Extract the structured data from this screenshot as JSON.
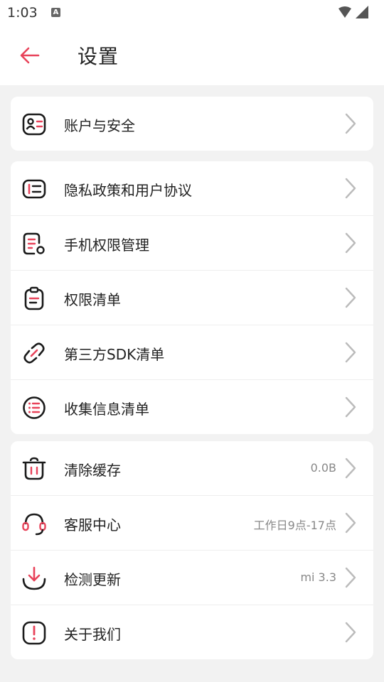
{
  "status": {
    "time": "1:03",
    "notif_glyph": "A"
  },
  "header": {
    "title": "设置"
  },
  "colors": {
    "accent": "#e8435a",
    "icon_dark": "#1a1a1a",
    "chevron": "#bbbbbb"
  },
  "groups": [
    {
      "items": [
        {
          "label": "账户与安全",
          "icon": "account-icon",
          "value": ""
        }
      ]
    },
    {
      "items": [
        {
          "label": "隐私政策和用户协议",
          "icon": "privacy-policy-icon",
          "value": ""
        },
        {
          "label": "手机权限管理",
          "icon": "permission-manage-icon",
          "value": ""
        },
        {
          "label": "权限清单",
          "icon": "clipboard-icon",
          "value": ""
        },
        {
          "label": "第三方SDK清单",
          "icon": "link-icon",
          "value": ""
        },
        {
          "label": "收集信息清单",
          "icon": "list-icon",
          "value": ""
        }
      ]
    },
    {
      "items": [
        {
          "label": "清除缓存",
          "icon": "trash-icon",
          "value": "0.0B"
        },
        {
          "label": "客服中心",
          "icon": "headset-icon",
          "value": "工作日9点-17点"
        },
        {
          "label": "检测更新",
          "icon": "download-icon",
          "value": "mi 3.3"
        },
        {
          "label": "关于我们",
          "icon": "exclamation-icon",
          "value": ""
        }
      ]
    }
  ]
}
